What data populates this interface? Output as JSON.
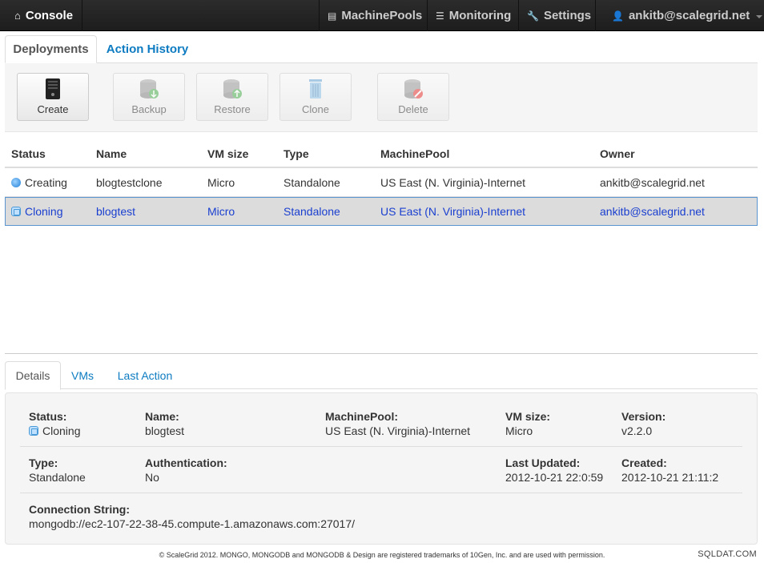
{
  "navbar": {
    "brand": "Console",
    "items": [
      {
        "label": "MachinePools",
        "icon": "storage-icon"
      },
      {
        "label": "Monitoring",
        "icon": "list-icon"
      },
      {
        "label": "Settings",
        "icon": "wrench-icon"
      }
    ],
    "user": "ankitb@scalegrid.net"
  },
  "tabs": [
    {
      "label": "Deployments",
      "active": true
    },
    {
      "label": "Action History",
      "active": false
    }
  ],
  "toolbar": [
    {
      "label": "Create",
      "enabled": true,
      "icon": "server-icon"
    },
    {
      "label": "Backup",
      "enabled": false,
      "icon": "database-backup-icon"
    },
    {
      "label": "Restore",
      "enabled": false,
      "icon": "database-restore-icon"
    },
    {
      "label": "Clone",
      "enabled": false,
      "icon": "trash-can-icon"
    },
    {
      "label": "Delete",
      "enabled": false,
      "icon": "database-delete-icon"
    }
  ],
  "table": {
    "columns": [
      "Status",
      "Name",
      "VM size",
      "Type",
      "MachinePool",
      "Owner"
    ],
    "rows": [
      {
        "status": "Creating",
        "name": "blogtestclone",
        "vm_size": "Micro",
        "type": "Standalone",
        "pool": "US East (N. Virginia)-Internet",
        "owner": "ankitb@scalegrid.net",
        "selected": false
      },
      {
        "status": "Cloning",
        "name": "blogtest",
        "vm_size": "Micro",
        "type": "Standalone",
        "pool": "US East (N. Virginia)-Internet",
        "owner": "ankitb@scalegrid.net",
        "selected": true
      }
    ]
  },
  "detail_tabs": [
    {
      "label": "Details",
      "active": true
    },
    {
      "label": "VMs",
      "active": false
    },
    {
      "label": "Last Action",
      "active": false
    }
  ],
  "details": {
    "status_label": "Status:",
    "status": "Cloning",
    "name_label": "Name:",
    "name": "blogtest",
    "pool_label": "MachinePool:",
    "pool": "US East (N. Virginia)-Internet",
    "vmsize_label": "VM size:",
    "vmsize": "Micro",
    "version_label": "Version:",
    "version": "v2.2.0",
    "type_label": "Type:",
    "type": "Standalone",
    "auth_label": "Authentication:",
    "auth": "No",
    "updated_label": "Last Updated:",
    "updated": "2012-10-21 22:0:59",
    "created_label": "Created:",
    "created": "2012-10-21 21:11:2",
    "conn_label": "Connection String:",
    "conn": "mongodb://ec2-107-22-38-45.compute-1.amazonaws.com:27017/"
  },
  "footer": "© ScaleGrid 2012. MONGO, MONGODB and MONGODB & Design are registered trademarks of 10Gen, Inc. and are used with permission.",
  "watermark": "SQLDAT.COM"
}
